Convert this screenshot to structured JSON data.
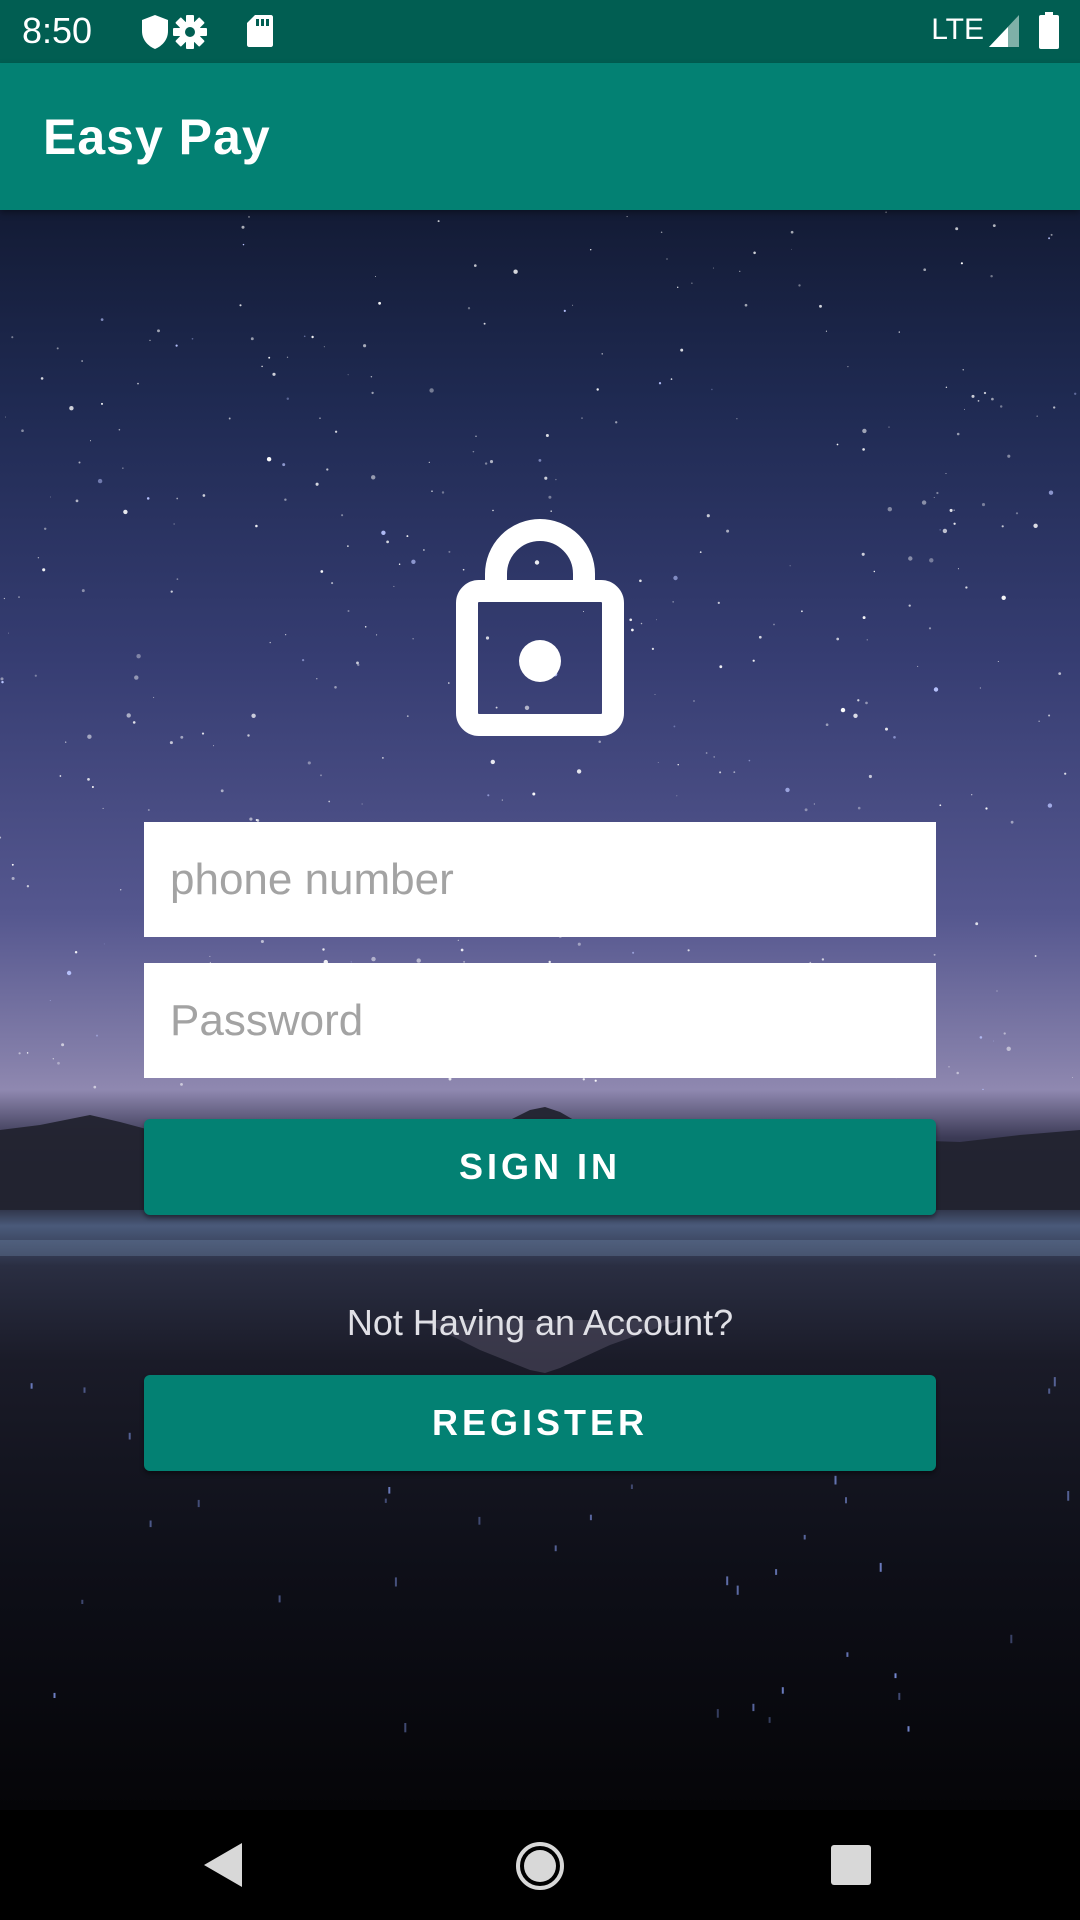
{
  "status_bar": {
    "time": "8:50",
    "network": "LTE",
    "icons": [
      "shield-icon",
      "settings-gear-icon",
      "sd-card-icon",
      "signal-icon",
      "battery-icon"
    ]
  },
  "app_bar": {
    "title": "Easy Pay",
    "color": "#038173"
  },
  "login_form": {
    "icon": "lock-icon",
    "phone": {
      "placeholder": "phone number",
      "value": ""
    },
    "password": {
      "placeholder": "Password",
      "value": ""
    },
    "sign_in_label": "SIGN IN",
    "no_account_text": "Not Having an Account?",
    "register_label": "REGISTER",
    "accent": "#038173"
  },
  "nav_bar": {
    "buttons": [
      "back-icon",
      "home-icon",
      "recents-icon"
    ]
  }
}
